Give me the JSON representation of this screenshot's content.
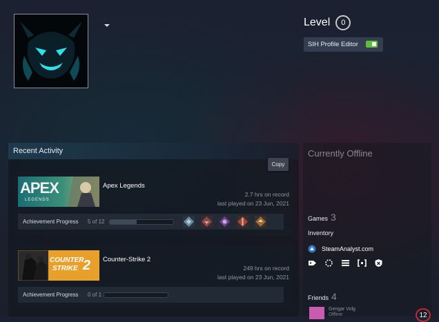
{
  "profile": {
    "level_label": "Level",
    "level_value": "0",
    "sih_button_label": "SIH Profile Editor",
    "sih_toggle_on": true
  },
  "recent_activity": {
    "title": "Recent Activity",
    "copy_tooltip": "Copy",
    "games": [
      {
        "name": "Apex Legends",
        "banner_text": "APEX",
        "banner_sub": "LEGENDS",
        "hours": "2.7 hrs on record",
        "last_played": "last played on 23 Jun, 2021",
        "achievement_label": "Achievement Progress",
        "achievement_count": "5 of 12",
        "achievement_fraction": 0.42
      },
      {
        "name": "Counter-Strike 2",
        "banner_text": "COUNTER",
        "banner_text2": "STRIKE",
        "banner_num": "2",
        "hours": "249 hrs on record",
        "last_played": "last played on 23 Jun, 2021",
        "achievement_label": "Achievement Progress",
        "achievement_count": "0 of 1",
        "achievement_fraction": 0
      }
    ]
  },
  "side": {
    "status": "Currently Offline",
    "games_label": "Games",
    "games_count": "3",
    "inventory_label": "Inventory",
    "steamanalyst_label": "SteamAnalyst.com",
    "tool_icons": [
      "tag-icon",
      "loader-icon",
      "list-icon",
      "bracket-icon",
      "shield-icon"
    ],
    "friends_label": "Friends",
    "friends_count": "4",
    "friend": {
      "name": "Gengar Volg",
      "status": "Offline",
      "level": "12"
    }
  },
  "colors": {
    "accent_blue": "#66c0f4",
    "toggle_green": "#5cbf3a",
    "level_red": "#c02a35"
  }
}
